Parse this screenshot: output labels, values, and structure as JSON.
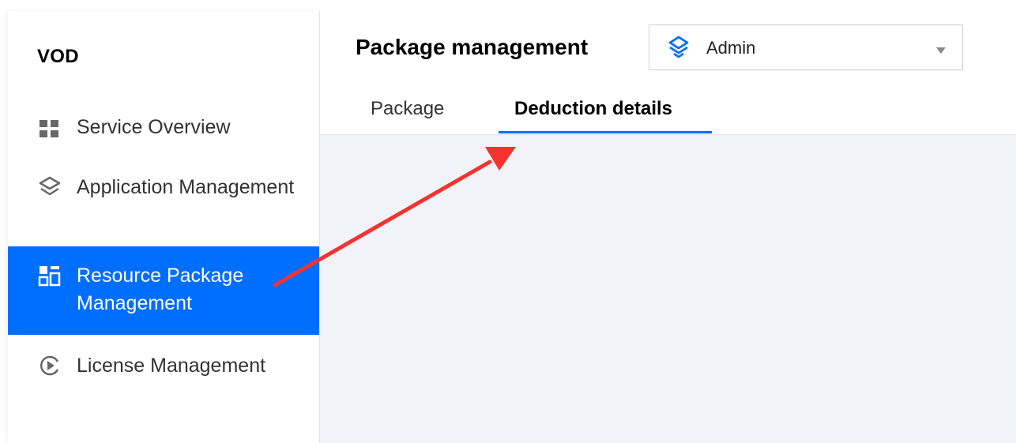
{
  "sidebar": {
    "app_title": "VOD",
    "items": [
      {
        "label": "Service Overview",
        "icon": "grid-icon",
        "active": false
      },
      {
        "label": "Application Management",
        "icon": "layers-icon",
        "active": false
      },
      {
        "label": "Resource Package Management",
        "icon": "package-icon",
        "active": true
      },
      {
        "label": "License Management",
        "icon": "play-circle-icon",
        "active": false
      }
    ]
  },
  "header": {
    "title": "Package management",
    "app_select": {
      "value": "Admin",
      "icon": "layers-app-icon"
    },
    "tabs": [
      {
        "label": "Package",
        "active": false
      },
      {
        "label": "Deduction details",
        "active": true
      }
    ]
  },
  "annotation": {
    "type": "arrow",
    "color": "#f5322e",
    "icon": "red-arrow"
  },
  "colors": {
    "accent": "#006eff",
    "content_bg": "#f2f3f8"
  }
}
